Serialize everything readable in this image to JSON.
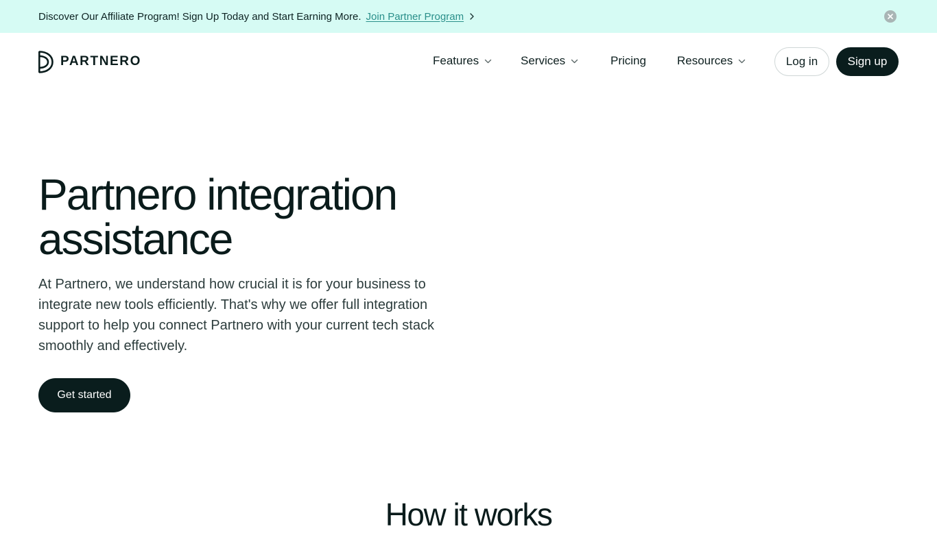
{
  "announcement": {
    "message": "Discover Our Affiliate Program! Sign Up Today and Start Earning More.",
    "link_label": "Join Partner Program",
    "link_color": "#2a8f8a",
    "background": "#d6fbf4",
    "icons": [
      "chevron-right-icon",
      "close-icon"
    ]
  },
  "header": {
    "logo_text": "PARTNERO",
    "nav": [
      {
        "label": "Features",
        "has_dropdown": true
      },
      {
        "label": "Services",
        "has_dropdown": true
      },
      {
        "label": "Pricing",
        "has_dropdown": false
      },
      {
        "label": "Resources",
        "has_dropdown": true
      }
    ],
    "login_label": "Log in",
    "signup_label": "Sign up"
  },
  "hero": {
    "title_line1": "Partnero integration",
    "title_line2": "assistance",
    "description": "At Partnero, we understand how crucial it is for your business to integrate new tools efficiently. That's why we offer full integration support to help you connect Partnero with your current tech stack smoothly and effectively.",
    "cta_label": "Get started"
  },
  "how_it_works": {
    "title": "How it works"
  },
  "colors": {
    "primary_dark": "#0a1d1d",
    "text": "#0a1b1b"
  }
}
